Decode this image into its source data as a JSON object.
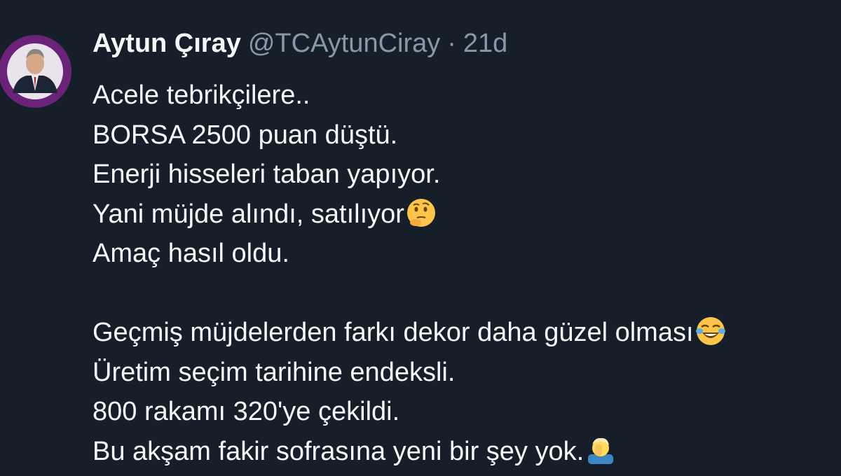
{
  "tweet": {
    "author_name": "Aytun Çıray",
    "author_handle": "@TCAytunCiray",
    "separator": "·",
    "timestamp": "21d",
    "lines": [
      "Acele tebrikçilere..",
      "BORSA 2500 puan düştü.",
      "Enerji hisseleri taban yapıyor.",
      "Yani müjde alındı, satılıyor",
      "Amaç hasıl oldu.",
      "",
      "Geçmiş müjdelerden farkı dekor daha güzel olması",
      "Üretim seçim tarihine endeksli.",
      "800 rakamı 320'ye çekildi.",
      "Bu akşam fakir sofrasına yeni bir şey yok."
    ],
    "emojis": {
      "line4": "thinking-face",
      "line7": "face-with-tears-of-joy",
      "line10": "person-facepalming"
    }
  },
  "colors": {
    "background": "#161e2a",
    "text": "#f5f8fa",
    "muted": "#8899a6",
    "avatar_ring": "#7b2a8c"
  }
}
